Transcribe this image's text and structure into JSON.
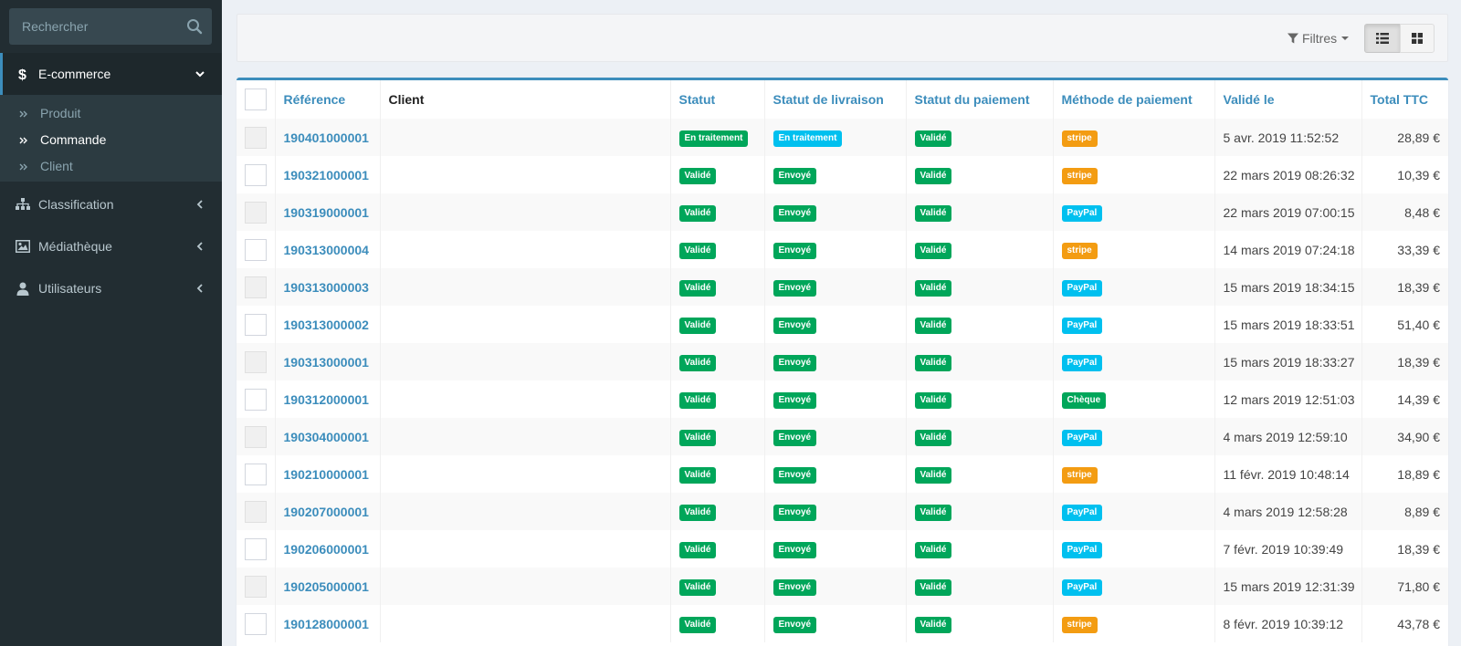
{
  "sidebar": {
    "search_placeholder": "Rechercher",
    "menu": [
      {
        "label": "E-commerce",
        "icon": "dollar-icon",
        "active": true,
        "expanded": true
      },
      {
        "label": "Classification",
        "icon": "sitemap-icon"
      },
      {
        "label": "Médiathèque",
        "icon": "image-icon"
      },
      {
        "label": "Utilisateurs",
        "icon": "user-icon"
      }
    ],
    "submenu": [
      {
        "label": "Produit"
      },
      {
        "label": "Commande",
        "active": true
      },
      {
        "label": "Client"
      }
    ]
  },
  "toolbar": {
    "filters_label": "Filtres",
    "view_mode": "list"
  },
  "table": {
    "headers": {
      "reference": "Référence",
      "client": "Client",
      "statut": "Statut",
      "livraison": "Statut de livraison",
      "paiement": "Statut du paiement",
      "methode": "Méthode de paiement",
      "valide_le": "Validé le",
      "total": "Total TTC"
    },
    "rows": [
      {
        "reference": "190401000001",
        "client": "",
        "statut": "En traitement",
        "livraison": "En traitement",
        "paiement": "Validé",
        "methode": "stripe",
        "valide_le": "5 avr. 2019 11:52:52",
        "total": "28,89 €"
      },
      {
        "reference": "190321000001",
        "client": "",
        "statut": "Validé",
        "livraison": "Envoyé",
        "paiement": "Validé",
        "methode": "stripe",
        "valide_le": "22 mars 2019 08:26:32",
        "total": "10,39 €"
      },
      {
        "reference": "190319000001",
        "client": "",
        "statut": "Validé",
        "livraison": "Envoyé",
        "paiement": "Validé",
        "methode": "PayPal",
        "valide_le": "22 mars 2019 07:00:15",
        "total": "8,48 €"
      },
      {
        "reference": "190313000004",
        "client": "",
        "statut": "Validé",
        "livraison": "Envoyé",
        "paiement": "Validé",
        "methode": "stripe",
        "valide_le": "14 mars 2019 07:24:18",
        "total": "33,39 €"
      },
      {
        "reference": "190313000003",
        "client": "",
        "statut": "Validé",
        "livraison": "Envoyé",
        "paiement": "Validé",
        "methode": "PayPal",
        "valide_le": "15 mars 2019 18:34:15",
        "total": "18,39 €"
      },
      {
        "reference": "190313000002",
        "client": "",
        "statut": "Validé",
        "livraison": "Envoyé",
        "paiement": "Validé",
        "methode": "PayPal",
        "valide_le": "15 mars 2019 18:33:51",
        "total": "51,40 €"
      },
      {
        "reference": "190313000001",
        "client": "",
        "statut": "Validé",
        "livraison": "Envoyé",
        "paiement": "Validé",
        "methode": "PayPal",
        "valide_le": "15 mars 2019 18:33:27",
        "total": "18,39 €"
      },
      {
        "reference": "190312000001",
        "client": "",
        "statut": "Validé",
        "livraison": "Envoyé",
        "paiement": "Validé",
        "methode": "Chèque",
        "valide_le": "12 mars 2019 12:51:03",
        "total": "14,39 €"
      },
      {
        "reference": "190304000001",
        "client": "",
        "statut": "Validé",
        "livraison": "Envoyé",
        "paiement": "Validé",
        "methode": "PayPal",
        "valide_le": "4 mars 2019 12:59:10",
        "total": "34,90 €"
      },
      {
        "reference": "190210000001",
        "client": "",
        "statut": "Validé",
        "livraison": "Envoyé",
        "paiement": "Validé",
        "methode": "stripe",
        "valide_le": "11 févr. 2019 10:48:14",
        "total": "18,89 €"
      },
      {
        "reference": "190207000001",
        "client": "",
        "statut": "Validé",
        "livraison": "Envoyé",
        "paiement": "Validé",
        "methode": "PayPal",
        "valide_le": "4 mars 2019 12:58:28",
        "total": "8,89 €"
      },
      {
        "reference": "190206000001",
        "client": "",
        "statut": "Validé",
        "livraison": "Envoyé",
        "paiement": "Validé",
        "methode": "PayPal",
        "valide_le": "7 févr. 2019 10:39:49",
        "total": "18,39 €"
      },
      {
        "reference": "190205000001",
        "client": "",
        "statut": "Validé",
        "livraison": "Envoyé",
        "paiement": "Validé",
        "methode": "PayPal",
        "valide_le": "15 mars 2019 12:31:39",
        "total": "71,80 €"
      },
      {
        "reference": "190128000001",
        "client": "",
        "statut": "Validé",
        "livraison": "Envoyé",
        "paiement": "Validé",
        "methode": "stripe",
        "valide_le": "8 févr. 2019 10:39:12",
        "total": "43,78 €"
      }
    ]
  },
  "badge_colors": {
    "Validé": "#00a65a",
    "Envoyé": "#00a65a",
    "Chèque": "#00a65a",
    "En traitement": "#00a65a",
    "En traitement_livraison": "#00c0ef",
    "stripe": "#f39c12",
    "PayPal": "#00c0ef"
  }
}
